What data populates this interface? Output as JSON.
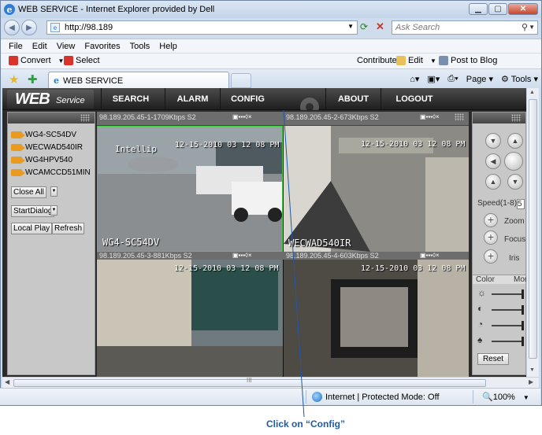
{
  "browser": {
    "title": "WEB SERVICE - Internet Explorer provided by Dell",
    "url": "http://98.189",
    "search_placeholder": "Ask Search",
    "menu": [
      "File",
      "Edit",
      "View",
      "Favorites",
      "Tools",
      "Help"
    ],
    "convert_label": "Convert",
    "select_label": "Select",
    "contribute_label": "Contribute",
    "edit_label": "Edit",
    "post_label": "Post to Blog",
    "tab_label": "WEB SERVICE",
    "page_label": "Page",
    "tools_label": "Tools",
    "status_zone": "Internet | Protected Mode: Off",
    "zoom": "100%",
    "scroll_grip": "III"
  },
  "app": {
    "logo_big": "WEB",
    "logo_small": "Service",
    "nav": [
      "SEARCH",
      "ALARM",
      "CONFIG",
      "ABOUT",
      "LOGOUT"
    ],
    "cameras": [
      "WG4-SC54DV",
      "WECWAD540IR",
      "WG4HPV540",
      "WCAMCCD51MIN"
    ],
    "buttons": {
      "close_all": "Close All",
      "start_dialog": "StartDialog",
      "local_play": "Local Play",
      "refresh": "Refresh"
    },
    "videos": [
      {
        "label": "98.189.205.45-1-1709Kbps S2",
        "overlay": "Intellip",
        "timestamp": "12-15-2010 03 12 08 PM",
        "name": "WG4-SC54DV",
        "bg": "#7a7f82"
      },
      {
        "label": "98.189.205.45-2-673Kbps S2",
        "overlay": "",
        "timestamp": "12-15-2010 03 12 08 PM",
        "name": "WECWAD540IR",
        "bg": "#8b8a84"
      },
      {
        "label": "98.189.205.45-3-881Kbps S2",
        "overlay": "",
        "timestamp": "12-15-2010 03 12 08 PM",
        "name": "",
        "bg": "#6e7a7e"
      },
      {
        "label": "98.189.205.45-4-603Kbps S2",
        "overlay": "",
        "timestamp": "12-15-2010 03 12 08 PM",
        "name": "",
        "bg": "#4e4a44"
      }
    ],
    "video_controls": "▣▪▪▪◊×",
    "ptz": {
      "speed_label": "Speed(1-8):",
      "speed_value": "5",
      "zoom": "Zoom",
      "focus": "Focus",
      "iris": "Iris",
      "color_tab": "Color",
      "more_tab": "Mor",
      "reset": "Reset"
    }
  },
  "annotation": "Click on “Config”"
}
